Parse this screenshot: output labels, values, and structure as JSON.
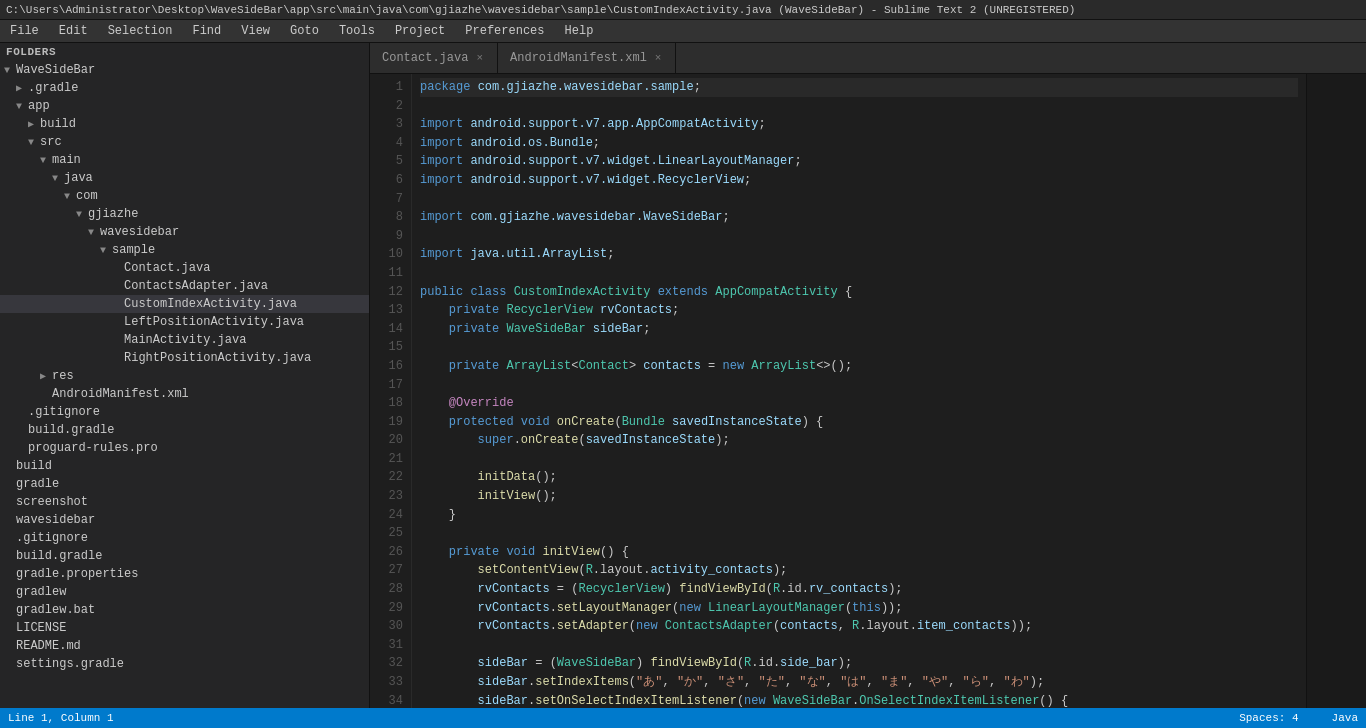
{
  "titlebar": {
    "text": "C:\\Users\\Administrator\\Desktop\\WaveSideBar\\app\\src\\main\\java\\com\\gjiazhe\\wavesidebar\\sample\\CustomIndexActivity.java (WaveSideBar) - Sublime Text 2 (UNREGISTERED)"
  },
  "menubar": {
    "items": [
      "File",
      "Edit",
      "Selection",
      "Find",
      "View",
      "Goto",
      "Tools",
      "Project",
      "Preferences",
      "Help"
    ]
  },
  "sidebar": {
    "header": "FOLDERS",
    "items": [
      {
        "id": "wavesidebar-root",
        "indent": 0,
        "arrow": "▼",
        "label": "WaveSideBar",
        "type": "folder"
      },
      {
        "id": "gradle-folder",
        "indent": 1,
        "arrow": "▶",
        "label": ".gradle",
        "type": "folder"
      },
      {
        "id": "app-folder",
        "indent": 1,
        "arrow": "▼",
        "label": "app",
        "type": "folder"
      },
      {
        "id": "build-folder",
        "indent": 2,
        "arrow": "▶",
        "label": "build",
        "type": "folder"
      },
      {
        "id": "src-folder",
        "indent": 2,
        "arrow": "▼",
        "label": "src",
        "type": "folder"
      },
      {
        "id": "main-folder",
        "indent": 3,
        "arrow": "▼",
        "label": "main",
        "type": "folder"
      },
      {
        "id": "java-folder",
        "indent": 4,
        "arrow": "▼",
        "label": "java",
        "type": "folder"
      },
      {
        "id": "com-folder",
        "indent": 5,
        "arrow": "▼",
        "label": "com",
        "type": "folder"
      },
      {
        "id": "gjiazhe-folder",
        "indent": 6,
        "arrow": "▼",
        "label": "gjiazhe",
        "type": "folder"
      },
      {
        "id": "wavesidebar-folder",
        "indent": 7,
        "arrow": "▼",
        "label": "wavesidebar",
        "type": "folder"
      },
      {
        "id": "sample-folder",
        "indent": 8,
        "arrow": "▼",
        "label": "sample",
        "type": "folder"
      },
      {
        "id": "contact-java",
        "indent": 9,
        "arrow": " ",
        "label": "Contact.java",
        "type": "file"
      },
      {
        "id": "contactsadapter-java",
        "indent": 9,
        "arrow": " ",
        "label": "ContactsAdapter.java",
        "type": "file"
      },
      {
        "id": "customindexactivity-java",
        "indent": 9,
        "arrow": " ",
        "label": "CustomIndexActivity.java",
        "type": "file",
        "selected": true
      },
      {
        "id": "leftpositionactivity-java",
        "indent": 9,
        "arrow": " ",
        "label": "LeftPositionActivity.java",
        "type": "file"
      },
      {
        "id": "mainactivity-java",
        "indent": 9,
        "arrow": " ",
        "label": "MainActivity.java",
        "type": "file"
      },
      {
        "id": "rightpositionactivity-java",
        "indent": 9,
        "arrow": " ",
        "label": "RightPositionActivity.java",
        "type": "file"
      },
      {
        "id": "res-folder",
        "indent": 3,
        "arrow": "▶",
        "label": "res",
        "type": "folder"
      },
      {
        "id": "androidmanifest-xml",
        "indent": 3,
        "arrow": " ",
        "label": "AndroidManifest.xml",
        "type": "file"
      },
      {
        "id": "gitignore-app",
        "indent": 1,
        "arrow": " ",
        "label": ".gitignore",
        "type": "file"
      },
      {
        "id": "build-gradle-app",
        "indent": 1,
        "arrow": " ",
        "label": "build.gradle",
        "type": "file"
      },
      {
        "id": "proguard-rules",
        "indent": 1,
        "arrow": " ",
        "label": "proguard-rules.pro",
        "type": "file"
      },
      {
        "id": "build-root",
        "indent": 0,
        "arrow": " ",
        "label": "build",
        "type": "folder-closed"
      },
      {
        "id": "gradle-root",
        "indent": 0,
        "arrow": " ",
        "label": "gradle",
        "type": "folder-closed"
      },
      {
        "id": "screenshot-root",
        "indent": 0,
        "arrow": " ",
        "label": "screenshot",
        "type": "folder-closed"
      },
      {
        "id": "wavesidebar-root2",
        "indent": 0,
        "arrow": " ",
        "label": "wavesidebar",
        "type": "folder-closed"
      },
      {
        "id": "gitignore-root",
        "indent": 0,
        "arrow": " ",
        "label": ".gitignore",
        "type": "file"
      },
      {
        "id": "build-gradle-root",
        "indent": 0,
        "arrow": " ",
        "label": "build.gradle",
        "type": "file"
      },
      {
        "id": "gradle-properties",
        "indent": 0,
        "arrow": " ",
        "label": "gradle.properties",
        "type": "file"
      },
      {
        "id": "gradlew",
        "indent": 0,
        "arrow": " ",
        "label": "gradlew",
        "type": "file"
      },
      {
        "id": "gradlew-bat",
        "indent": 0,
        "arrow": " ",
        "label": "gradlew.bat",
        "type": "file"
      },
      {
        "id": "license",
        "indent": 0,
        "arrow": " ",
        "label": "LICENSE",
        "type": "file"
      },
      {
        "id": "readme",
        "indent": 0,
        "arrow": " ",
        "label": "README.md",
        "type": "file"
      },
      {
        "id": "settings-gradle",
        "indent": 0,
        "arrow": " ",
        "label": "settings.gradle",
        "type": "file"
      }
    ]
  },
  "tabs": [
    {
      "id": "contact-tab",
      "label": "Contact.java",
      "active": false
    },
    {
      "id": "androidmanifest-tab",
      "label": "AndroidManifest.xml",
      "active": false
    }
  ],
  "statusbar": {
    "left": "Line 1, Column 1",
    "right_spaces": "Spaces: 4",
    "right_lang": "Java"
  }
}
